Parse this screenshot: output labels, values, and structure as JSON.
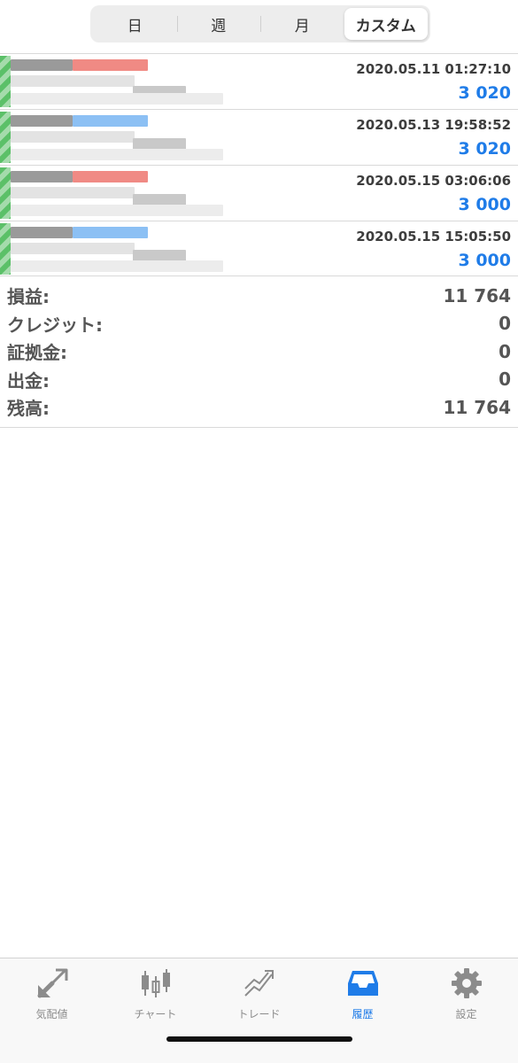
{
  "segments": [
    {
      "label": "日",
      "active": false
    },
    {
      "label": "週",
      "active": false
    },
    {
      "label": "月",
      "active": false
    },
    {
      "label": "カスタム",
      "active": true
    }
  ],
  "deals": [
    {
      "datetime": "2020.05.11 01:27:10",
      "amount": "3 020",
      "accent": "#f08a84"
    },
    {
      "datetime": "2020.05.13 19:58:52",
      "amount": "3 020",
      "accent": "#8cc0f4"
    },
    {
      "datetime": "2020.05.15 03:06:06",
      "amount": "3 000",
      "accent": "#f08a84"
    },
    {
      "datetime": "2020.05.15 15:05:50",
      "amount": "3 000",
      "accent": "#8cc0f4"
    }
  ],
  "summary": [
    {
      "label": "損益:",
      "value": "11 764"
    },
    {
      "label": "クレジット:",
      "value": "0"
    },
    {
      "label": "証拠金:",
      "value": "0"
    },
    {
      "label": "出金:",
      "value": "0"
    },
    {
      "label": "残高:",
      "value": "11 764"
    }
  ],
  "tabbar": [
    {
      "label": "気配値",
      "icon": "quotes-arrows-icon",
      "active": false
    },
    {
      "label": "チャート",
      "icon": "candlestick-chart-icon",
      "active": false
    },
    {
      "label": "トレード",
      "icon": "trade-trend-icon",
      "active": false
    },
    {
      "label": "履歴",
      "icon": "history-inbox-icon",
      "active": true
    },
    {
      "label": "設定",
      "icon": "settings-gear-icon",
      "active": false
    }
  ],
  "colors": {
    "accent": "#1f7ce8",
    "text": "#333333",
    "positive_edge": "#49b957"
  }
}
